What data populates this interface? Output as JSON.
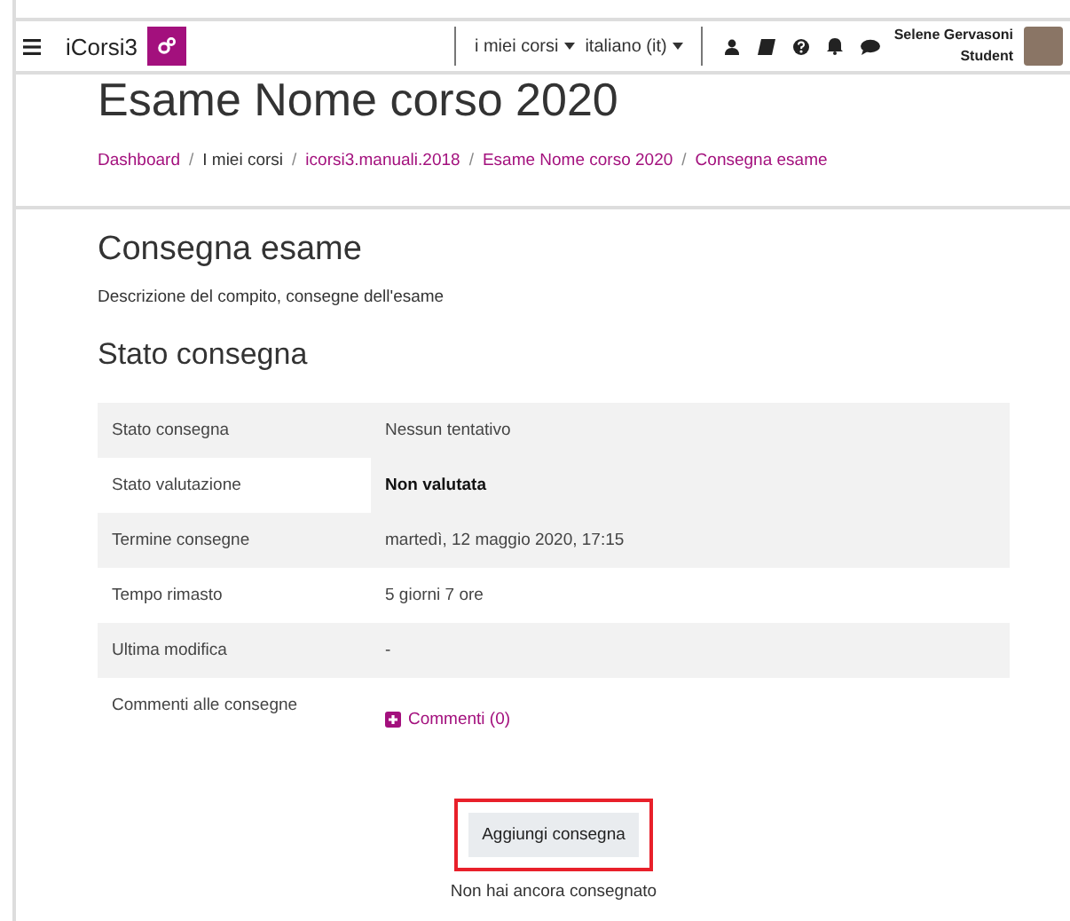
{
  "navbar": {
    "brand": "iCorsi3",
    "menus": [
      {
        "label": "i miei corsi"
      },
      {
        "label": "italiano (it)"
      }
    ],
    "user": {
      "name": "Selene Gervasoni",
      "role": "Student"
    }
  },
  "page_title": "Esame Nome corso 2020",
  "breadcrumb": [
    {
      "label": "Dashboard",
      "link": true
    },
    {
      "separator": "/",
      "label": "I miei corsi",
      "link": false
    },
    {
      "separator": "/",
      "label": "icorsi3.manuali.2018",
      "link": true
    },
    {
      "separator": "/",
      "label": "Esame Nome corso 2020",
      "link": true
    },
    {
      "separator": "/",
      "label": "Consegna esame",
      "link": true
    }
  ],
  "activity_title": "Consegna esame",
  "description": "Descrizione del compito, consegne dell'esame",
  "status_heading": "Stato consegna",
  "rows": [
    {
      "label": "Stato consegna",
      "value": "Nessun tentativo",
      "striped": true
    },
    {
      "label": "Stato valutazione",
      "value": "Non valutata",
      "striped": false,
      "value_highlighted": true
    },
    {
      "label": "Termine consegne",
      "value": "martedì, 12 maggio 2020, 17:15",
      "striped": true
    },
    {
      "label": "Tempo rimasto",
      "value": "5 giorni 7 ore",
      "striped": false
    },
    {
      "label": "Ultima modifica",
      "value": "-",
      "striped": true
    },
    {
      "label": "Commenti alle consegne",
      "link": "Commenti (0)",
      "striped": false
    }
  ],
  "submit_button": {
    "label": "Aggiungi consegna",
    "highlighted": true
  },
  "footer_note": "Non hai ancora consegnato"
}
